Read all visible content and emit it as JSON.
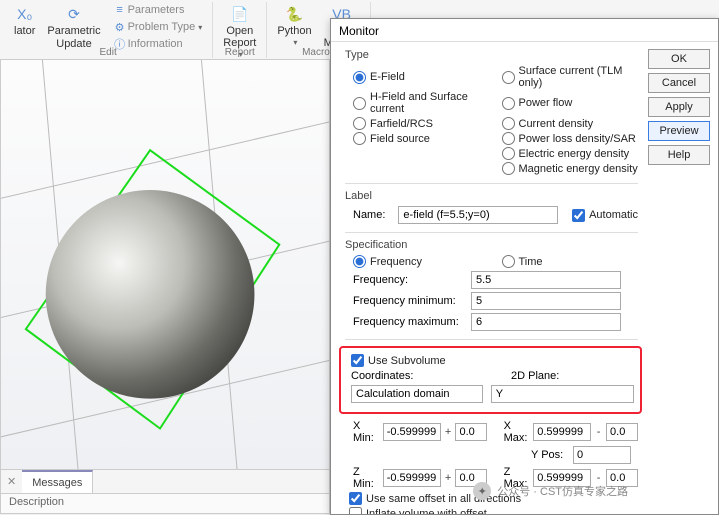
{
  "ribbon": {
    "group_edit": "Edit",
    "group_report": "Report",
    "group_macros": "Macros",
    "lator": "lator",
    "parametric": "Parametric",
    "update": "Update",
    "parameters": "Parameters",
    "problem_type": "Problem Type",
    "information": "Information",
    "open_report": "Open\nReport",
    "python": "Python",
    "vba_macros": "VBA\nMacros"
  },
  "bottom": {
    "messages": "Messages",
    "description": "Description"
  },
  "dialog": {
    "title": "Monitor",
    "buttons": {
      "ok": "OK",
      "cancel": "Cancel",
      "apply": "Apply",
      "preview": "Preview",
      "help": "Help"
    },
    "type": {
      "legend": "Type",
      "efield": "E-Field",
      "hfield": "H-Field and Surface current",
      "farfield": "Farfield/RCS",
      "fieldsource": "Field source",
      "surface_tlm": "Surface current (TLM only)",
      "powerflow": "Power flow",
      "current_density": "Current density",
      "power_loss": "Power loss density/SAR",
      "electric_energy": "Electric energy density",
      "magnetic_energy": "Magnetic energy density"
    },
    "label": {
      "legend": "Label",
      "name_lbl": "Name:",
      "name_val": "e-field (f=5.5;y=0)",
      "automatic": "Automatic"
    },
    "spec": {
      "legend": "Specification",
      "frequency_radio": "Frequency",
      "time_radio": "Time",
      "frequency_lbl": "Frequency:",
      "frequency_val": "5.5",
      "fmin_lbl": "Frequency minimum:",
      "fmin_val": "5",
      "fmax_lbl": "Frequency maximum:",
      "fmax_val": "6"
    },
    "subvol": {
      "use_subvolume": "Use Subvolume",
      "coords_lbl": "Coordinates:",
      "coords_val": "Calculation domain",
      "plane_lbl": "2D Plane:",
      "plane_val": "Y",
      "xmin_lbl": "X Min:",
      "xmin_val": "-0.599999",
      "xmin_off": "0.0",
      "xmax_lbl": "X Max:",
      "xmax_val": "0.599999",
      "xmax_off": "0.0",
      "ypos_lbl": "Y Pos:",
      "ypos_val": "0",
      "zmin_lbl": "Z Min:",
      "zmin_val": "-0.599999",
      "zmin_off": "0.0",
      "zmax_lbl": "Z Max:",
      "zmax_val": "0.599999",
      "zmax_off": "0.0",
      "same_offset": "Use same offset in all directions",
      "inflate": "Inflate volume with offset"
    }
  },
  "watermark": "公众号 · CST仿真专家之路"
}
